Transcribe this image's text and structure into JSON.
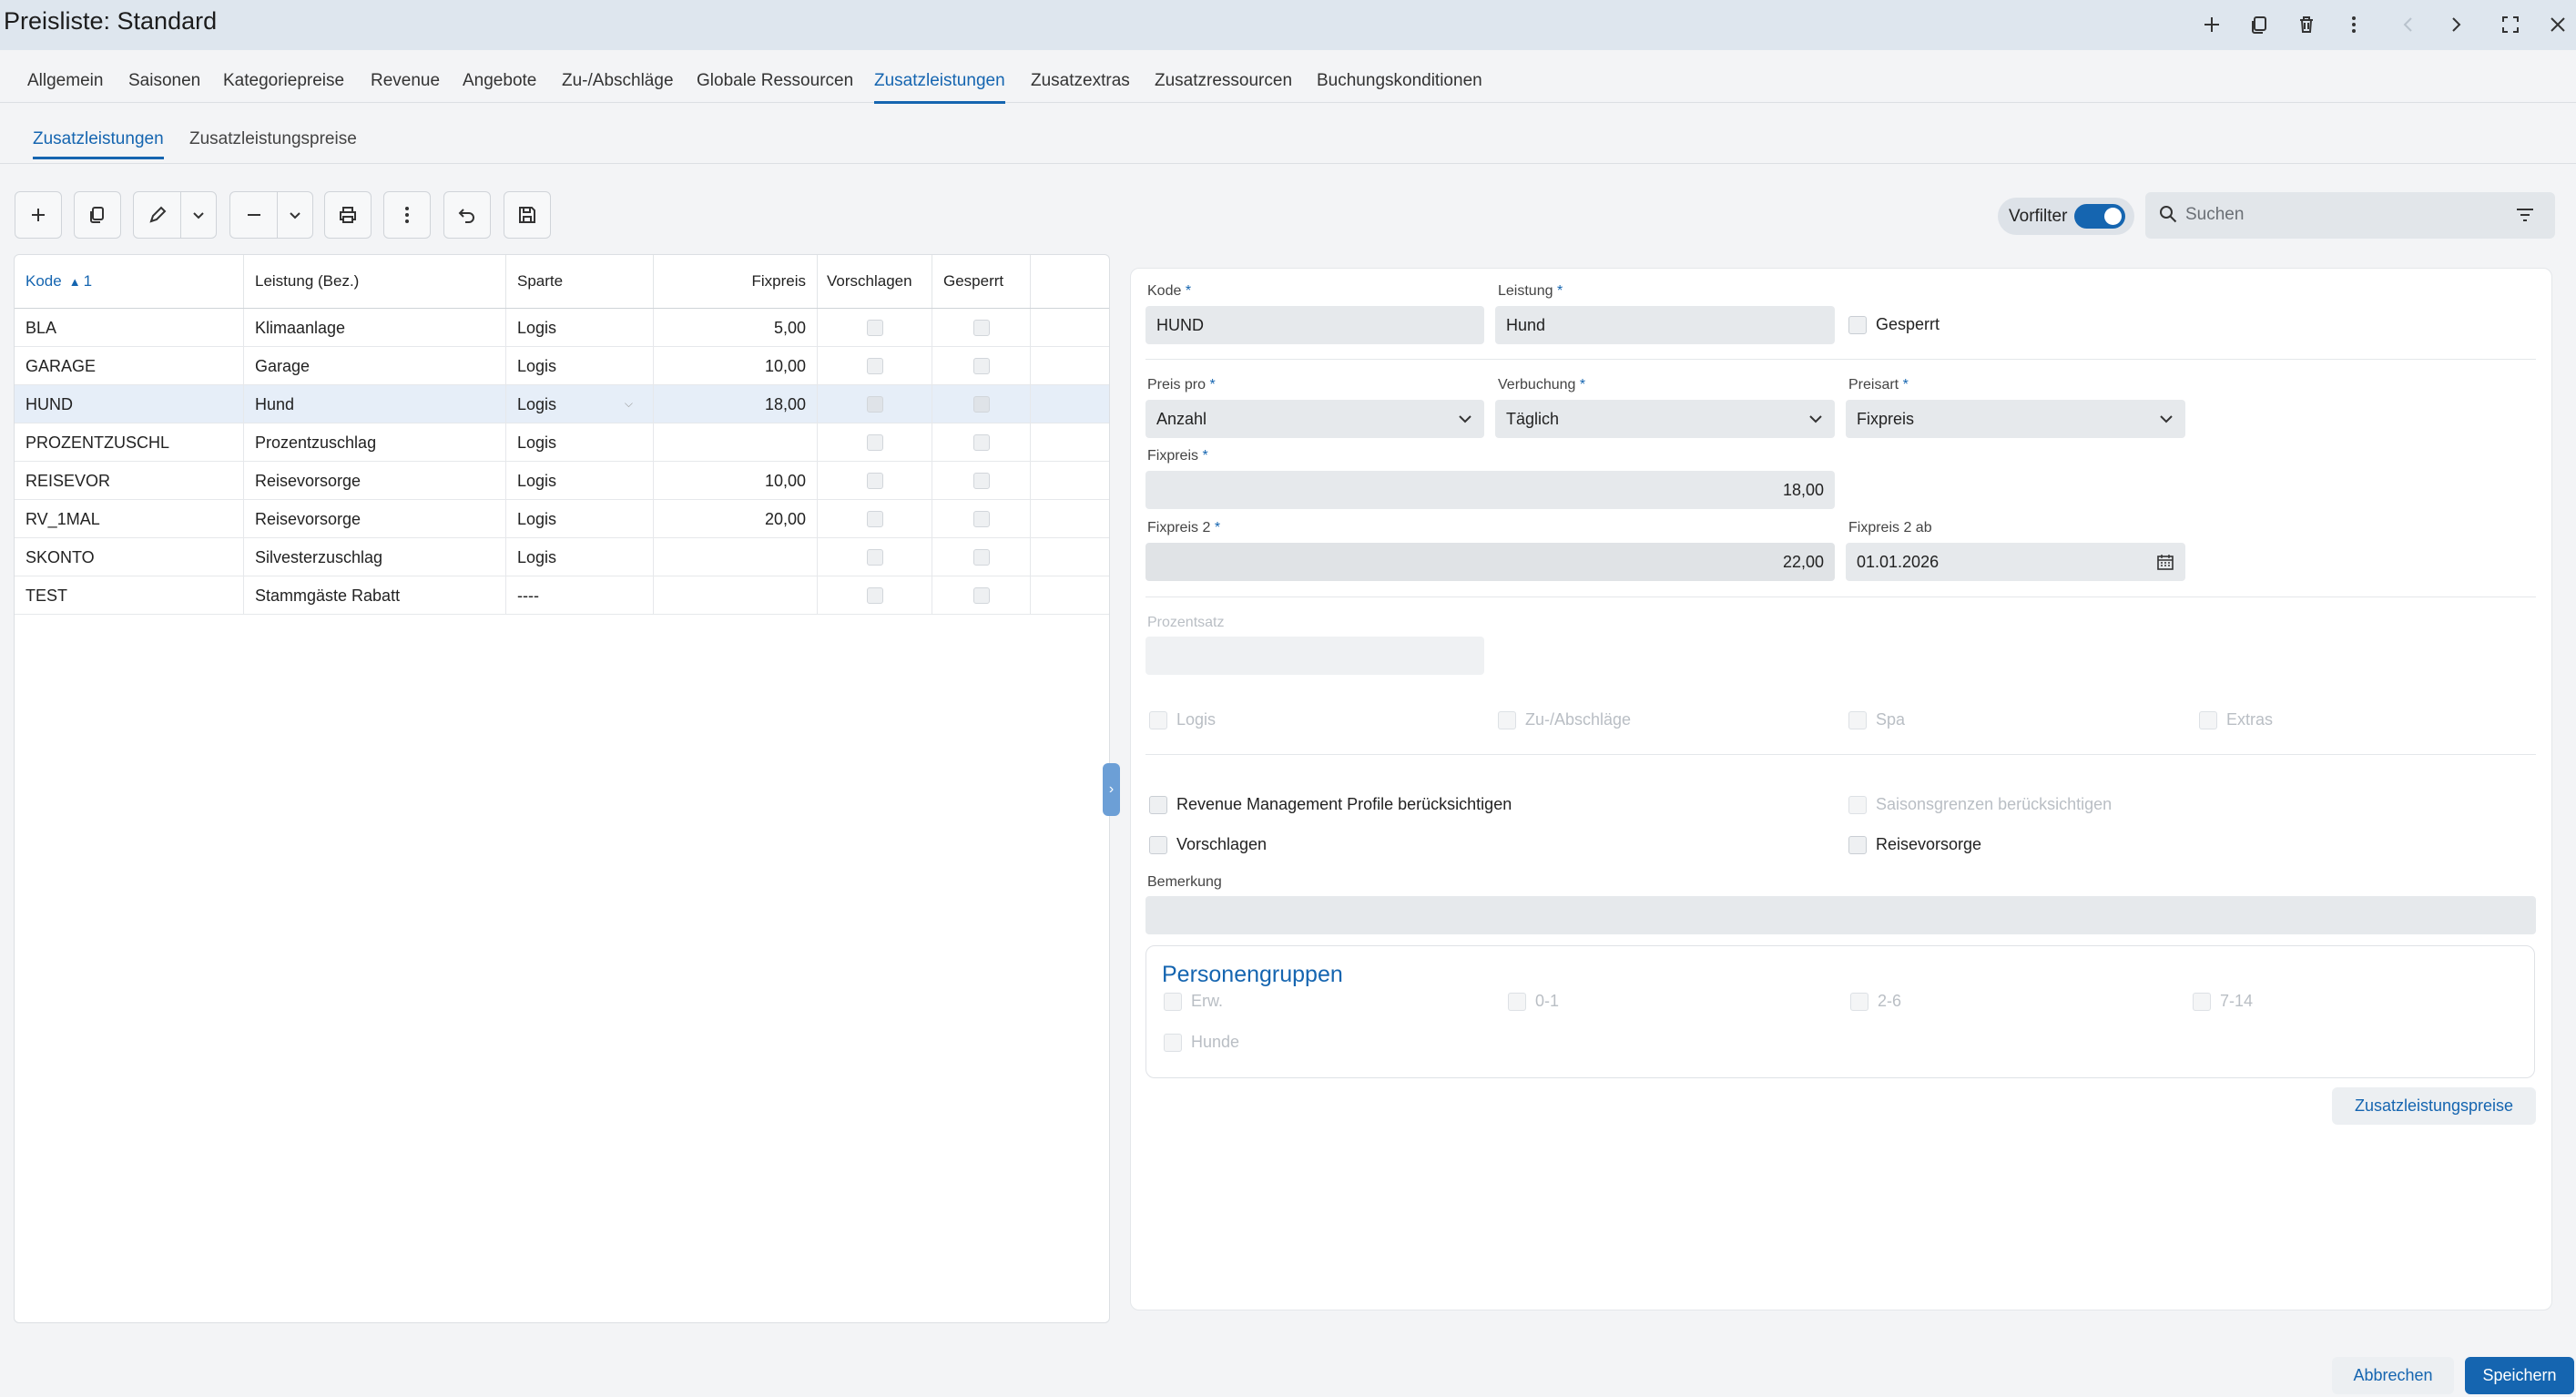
{
  "window": {
    "title": "Preisliste: Standard",
    "icons": [
      "plus-icon",
      "copy-icon",
      "trash-icon",
      "more-vertical-icon",
      "chevron-left-icon",
      "chevron-right-icon",
      "fullscreen-icon",
      "close-icon"
    ]
  },
  "main_tabs": [
    "Allgemein",
    "Saisonen",
    "Kategoriepreise",
    "Revenue",
    "Angebote",
    "Zu-/Abschläge",
    "Globale Ressourcen",
    "Zusatzleistungen",
    "Zusatzextras",
    "Zusatzressourcen",
    "Buchungskonditionen"
  ],
  "main_tab_active": "Zusatzleistungen",
  "sub_tabs": [
    "Zusatzleistungen",
    "Zusatzleistungspreise"
  ],
  "sub_tab_active": "Zusatzleistungen",
  "toolbar": {
    "buttons": [
      "plus-icon",
      "copy-icon",
      "edit-icon",
      "chevron-down-icon",
      "minus-icon",
      "chevron-down-icon",
      "print-icon",
      "more-vertical-icon",
      "undo-icon",
      "save-icon"
    ],
    "vorfilter_label": "Vorfilter",
    "vorfilter_on": true,
    "search_placeholder": "Suchen"
  },
  "grid": {
    "columns": [
      "Kode",
      "Leistung (Bez.)",
      "Sparte",
      "Fixpreis",
      "Vorschlagen",
      "Gesperrt"
    ],
    "sort_indicator": "1",
    "rows": [
      {
        "kode": "BLA",
        "leistung": "Klimaanlage",
        "sparte": "Logis",
        "fixpreis": "5,00"
      },
      {
        "kode": "GARAGE",
        "leistung": "Garage",
        "sparte": "Logis",
        "fixpreis": "10,00"
      },
      {
        "kode": "HUND",
        "leistung": "Hund",
        "sparte": "Logis",
        "fixpreis": "18,00"
      },
      {
        "kode": "PROZENTZUSCHL",
        "leistung": "Prozentzuschlag",
        "sparte": "Logis",
        "fixpreis": ""
      },
      {
        "kode": "REISEVOR",
        "leistung": "Reisevorsorge",
        "sparte": "Logis",
        "fixpreis": "10,00"
      },
      {
        "kode": "RV_1MAL",
        "leistung": "Reisevorsorge",
        "sparte": "Logis",
        "fixpreis": "20,00"
      },
      {
        "kode": "SKONTO",
        "leistung": "Silvesterzuschlag",
        "sparte": "Logis",
        "fixpreis": ""
      },
      {
        "kode": "TEST",
        "leistung": "Stammgäste Rabatt",
        "sparte": "----",
        "fixpreis": ""
      }
    ],
    "selected_row": "HUND"
  },
  "detail": {
    "kode_label": "Kode",
    "kode_value": "HUND",
    "leistung_label": "Leistung",
    "leistung_value": "Hund",
    "gesperrt_label": "Gesperrt",
    "preis_pro_label": "Preis pro",
    "preis_pro_value": "Anzahl",
    "verbuchung_label": "Verbuchung",
    "verbuchung_value": "Täglich",
    "preisart_label": "Preisart",
    "preisart_value": "Fixpreis",
    "fixpreis_label": "Fixpreis",
    "fixpreis_value": "18,00",
    "fixpreis2_label": "Fixpreis 2",
    "fixpreis2_value": "22,00",
    "fixpreis2ab_label": "Fixpreis 2 ab",
    "fixpreis2ab_value": "01.01.2026",
    "prozentsatz_label": "Prozentsatz",
    "scope_checks": [
      "Logis",
      "Zu-/Abschläge",
      "Spa",
      "Extras"
    ],
    "revenue_label": "Revenue Management Profile berücksichtigen",
    "saisongrenzen_label": "Saisonsgrenzen berücksichtigen",
    "vorschlagen_label": "Vorschlagen",
    "reisevorsorge_label": "Reisevorsorge",
    "bemerkung_label": "Bemerkung",
    "personengruppen_title": "Personengruppen",
    "personengruppen": [
      "Erw.",
      "0-1",
      "2-6",
      "7-14",
      "Hunde"
    ],
    "zusatz_button": "Zusatzleistungspreise"
  },
  "footer": {
    "cancel": "Abbrechen",
    "save": "Speichern"
  },
  "colors": {
    "accent": "#1565b0",
    "titlebar": "#dee6ee",
    "selected_row": "#e6eef8"
  }
}
